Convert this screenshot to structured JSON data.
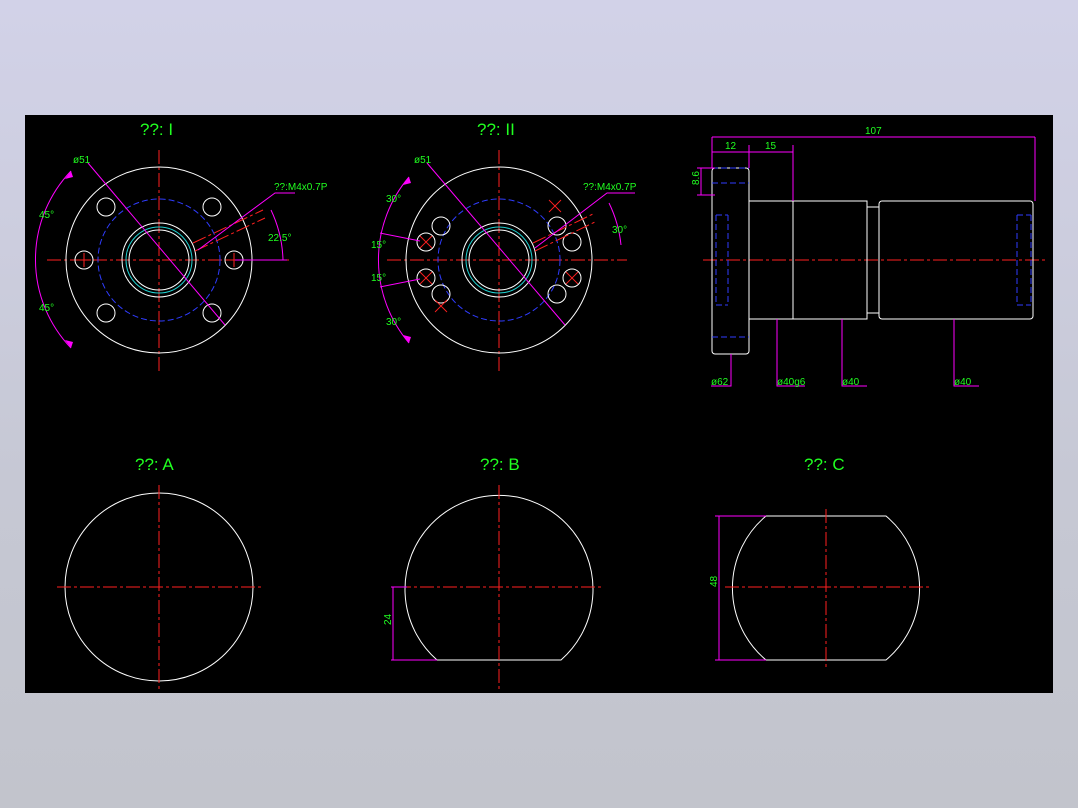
{
  "views": {
    "view_1": {
      "title": "??: I",
      "dia_label": "ø51",
      "thread_label": "??:M4x0.7P",
      "angle_top": "45°",
      "angle_bottom": "45°",
      "angle_right": "22.5°"
    },
    "view_2": {
      "title": "??: II",
      "dia_label": "ø51",
      "thread_label": "??:M4x0.7P",
      "angle_a": "30°",
      "angle_b": "15°",
      "angle_c": "15°",
      "angle_d": "30°",
      "angle_right": "30°"
    },
    "side_view": {
      "dim_total": "107",
      "dim_flange": "12",
      "dim_step": "15",
      "dim_height": "8.6",
      "dia_flange": "ø62",
      "dia_body": "ø40g6",
      "dia_mid": "ø40",
      "dia_right": "ø40"
    },
    "view_a": {
      "title": "??: A"
    },
    "view_b": {
      "title": "??: B",
      "dim": "24"
    },
    "view_c": {
      "title": "??: C",
      "dim": "48"
    }
  },
  "colors": {
    "background": "#000000",
    "outline": "#ffffff",
    "center": "#ff2020",
    "hidden": "#2f3cff",
    "dimension": "#ff00ff",
    "text": "#20ff20",
    "frame": "#c8cad8"
  }
}
